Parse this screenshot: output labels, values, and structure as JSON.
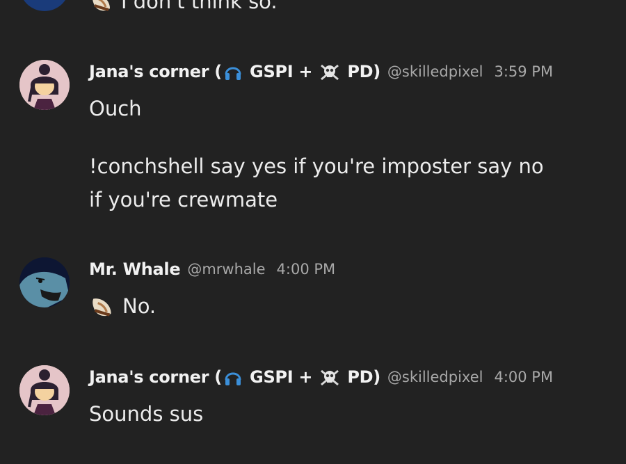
{
  "messages": [
    {
      "id": "prev",
      "text": "I don't think so."
    },
    {
      "id": "m1",
      "author_prefix": "Jana's corner (",
      "author_mid": " GSPI + ",
      "author_suffix": " PD)",
      "handle": "@skilledpixel",
      "time": "3:59 PM",
      "lines": [
        "Ouch",
        "!conchshell say yes if you're imposter say no",
        "if you're crewmate"
      ]
    },
    {
      "id": "m2",
      "author": "Mr. Whale",
      "handle": "@mrwhale",
      "time": "4:00 PM",
      "text": "No."
    },
    {
      "id": "m3",
      "author_prefix": "Jana's corner (",
      "author_mid": " GSPI + ",
      "author_suffix": " PD)",
      "handle": "@skilledpixel",
      "time": "4:00 PM",
      "text": "Sounds sus"
    }
  ],
  "icons": {
    "headphones": "headphones-icon",
    "skull": "skull-crossbones-icon",
    "conch": "conch-shell-icon"
  },
  "colors": {
    "background": "#222222",
    "name": "#f2f2f2",
    "meta": "#a9a9a9",
    "text": "#ececec",
    "headphones": "#3b8fd9"
  }
}
